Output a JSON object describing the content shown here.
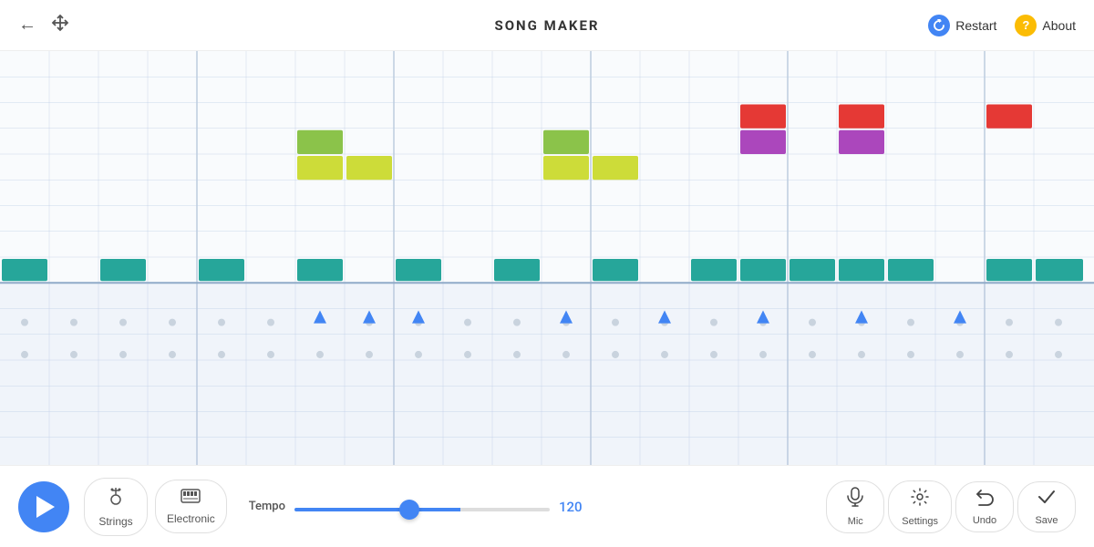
{
  "header": {
    "title": "SONG MAKER",
    "back_label": "←",
    "move_label": "⤢",
    "restart_label": "Restart",
    "about_label": "About",
    "restart_icon": "↺",
    "about_icon": "?"
  },
  "toolbar": {
    "play_label": "Play",
    "instruments": [
      {
        "label": "Strings",
        "icon": "🎻",
        "active": false
      },
      {
        "label": "Electronic",
        "icon": "🎹",
        "active": false
      }
    ],
    "tempo_label": "Tempo",
    "tempo_value": "120",
    "controls": [
      {
        "label": "Mic",
        "icon": "🎤"
      },
      {
        "label": "Settings",
        "icon": "⚙"
      },
      {
        "label": "Undo",
        "icon": "↩"
      },
      {
        "label": "Save",
        "icon": "✓"
      }
    ]
  },
  "grid": {
    "melody_notes": [
      {
        "col": 7,
        "row": 5,
        "color": "#8bc34a",
        "w": 1,
        "h": 1
      },
      {
        "col": 7,
        "row": 6,
        "color": "#cddc39",
        "w": 2,
        "h": 1
      },
      {
        "col": 8,
        "row": 6,
        "color": "#cddc39",
        "w": 1,
        "h": 1
      },
      {
        "col": 12,
        "row": 5,
        "color": "#8bc34a",
        "w": 1,
        "h": 1
      },
      {
        "col": 12,
        "row": 6,
        "color": "#cddc39",
        "w": 2,
        "h": 1
      },
      {
        "col": 13,
        "row": 6,
        "color": "#cddc39",
        "w": 1,
        "h": 1
      },
      {
        "col": 16,
        "row": 4,
        "color": "#e53935",
        "w": 1,
        "h": 1
      },
      {
        "col": 16,
        "row": 5,
        "color": "#ab47bc",
        "w": 1,
        "h": 1
      },
      {
        "col": 18,
        "row": 4,
        "color": "#e53935",
        "w": 1,
        "h": 1
      },
      {
        "col": 18,
        "row": 5,
        "color": "#ab47bc",
        "w": 1,
        "h": 1
      },
      {
        "col": 20,
        "row": 4,
        "color": "#e53935",
        "w": 1,
        "h": 1
      }
    ],
    "percussion_notes": [
      0,
      2,
      4,
      6,
      8,
      10,
      12,
      14,
      16,
      18,
      20
    ]
  }
}
